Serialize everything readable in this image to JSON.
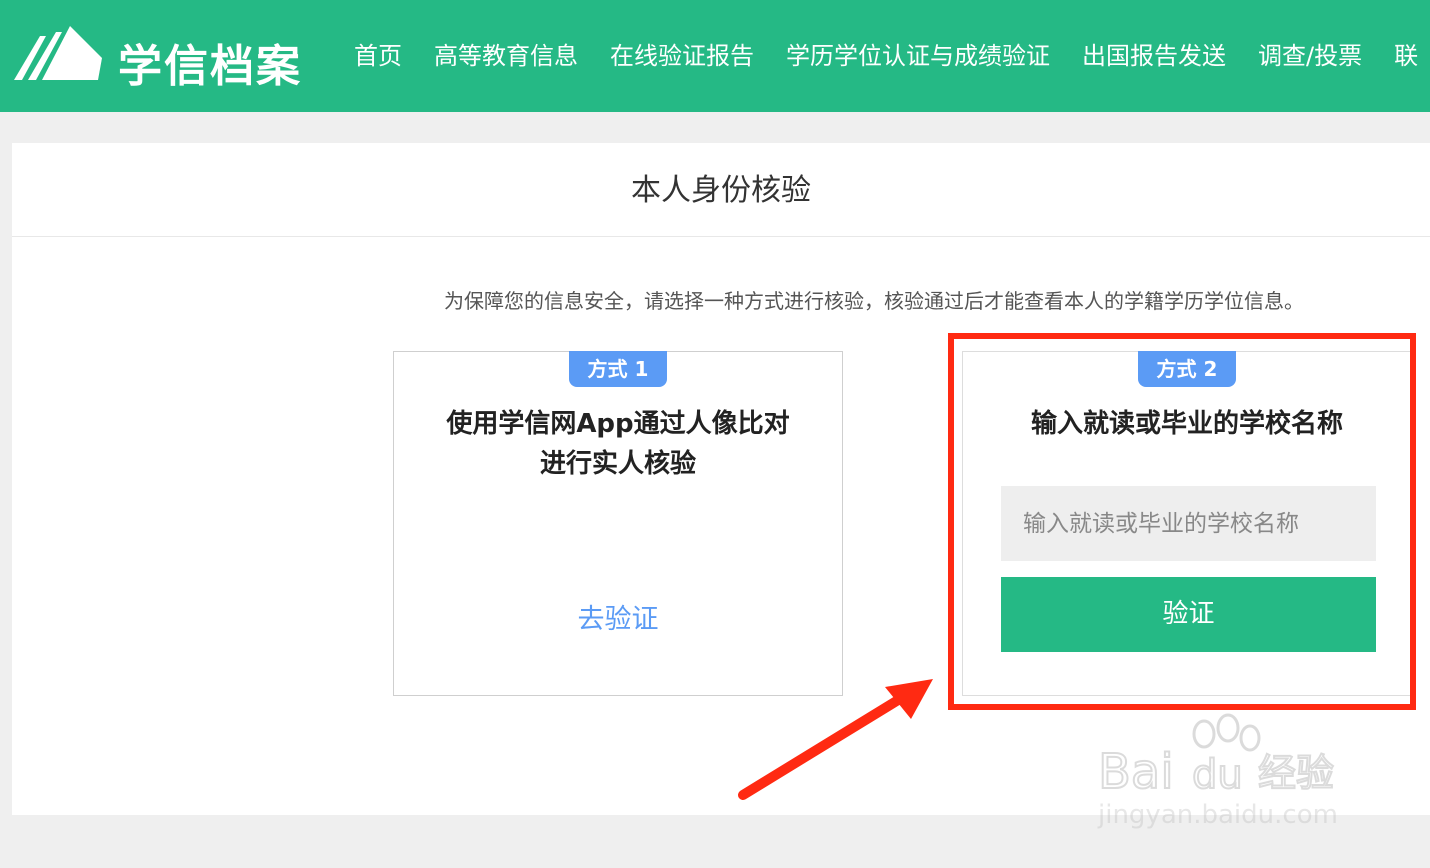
{
  "brand": {
    "name": "学信档案",
    "color": "#25b985"
  },
  "nav": {
    "items": [
      "首页",
      "高等教育信息",
      "在线验证报告",
      "学历学位认证与成绩验证",
      "出国报告发送",
      "调查/投票",
      "联"
    ]
  },
  "page": {
    "title": "本人身份核验",
    "notice": "为保障您的信息安全，请选择一种方式进行核验，核验通过后才能查看本人的学籍学历学位信息。"
  },
  "method1": {
    "badge": "方式 1",
    "title": "使用学信网App通过人像比对进行实人核验",
    "link": "去验证"
  },
  "method2": {
    "badge": "方式 2",
    "title": "输入就读或毕业的学校名称",
    "input_placeholder": "输入就读或毕业的学校名称",
    "input_value": "",
    "button": "验证"
  },
  "annotation": {
    "highlight_color": "#ff2a12"
  },
  "watermark": {
    "logo": "Bai du 经验",
    "url": "jingyan.baidu.com"
  },
  "colors": {
    "badge": "#5b9bf5",
    "link": "#5b9bf5"
  }
}
